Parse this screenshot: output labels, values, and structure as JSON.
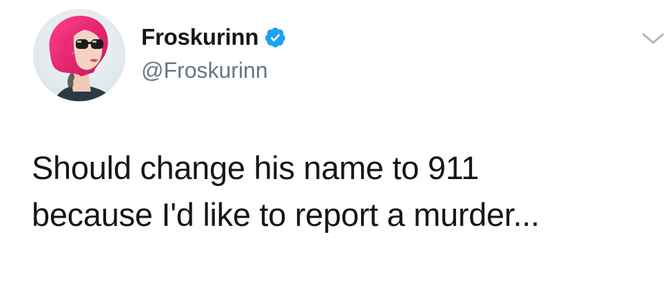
{
  "author": {
    "display_name": "Froskurinn",
    "handle": "@Froskurinn",
    "verified": true,
    "verified_icon": "verified-badge-icon",
    "avatar_icon": "profile-photo"
  },
  "tweet": {
    "lines": [
      "Should change his name to 911",
      "because I'd like to report a murder..."
    ]
  },
  "menu": {
    "icon": "chevron-down-icon"
  },
  "colors": {
    "name_text": "#14171a",
    "handle_text": "#657786",
    "verified_blue": "#1da1f2",
    "caret": "#aab8c2",
    "background": "#ffffff"
  }
}
